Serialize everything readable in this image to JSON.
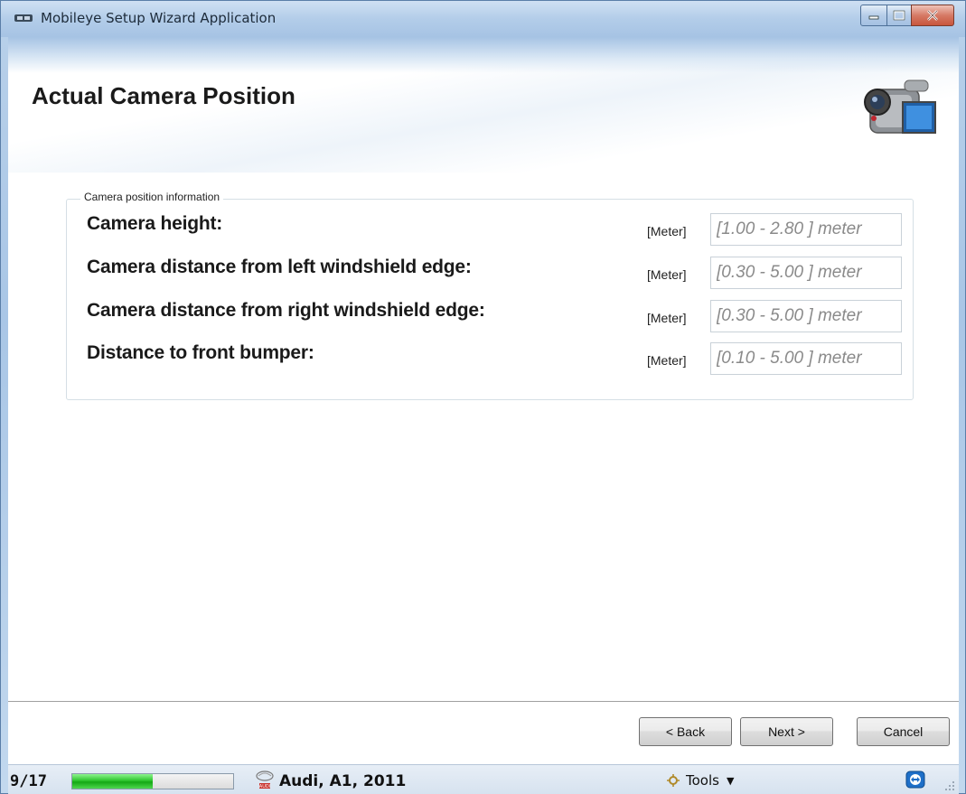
{
  "window": {
    "title": "Mobileye Setup Wizard Application",
    "controls": {
      "minimize": "minimize",
      "maximize": "maximize",
      "close": "close"
    }
  },
  "header": {
    "title": "Actual Camera Position",
    "icon": "camcorder-icon"
  },
  "group": {
    "legend": "Camera position information",
    "rows": [
      {
        "label": "Camera height:",
        "unit": "[Meter]",
        "placeholder": "[1.00 - 2.80 ] meter"
      },
      {
        "label": "Camera distance from left windshield edge:",
        "unit": "[Meter]",
        "placeholder": "[0.30 - 5.00 ] meter"
      },
      {
        "label": "Camera distance from right windshield edge:",
        "unit": "[Meter]",
        "placeholder": "[0.30 - 5.00 ] meter"
      },
      {
        "label": "Distance to front bumper:",
        "unit": "[Meter]",
        "placeholder": "[0.10 - 5.00 ] meter"
      }
    ]
  },
  "buttons": {
    "back": "< Back",
    "next": "Next >",
    "cancel": "Cancel"
  },
  "status": {
    "step": "9/17",
    "progress_fraction": 0.5,
    "vehicle": "Audi, A1, 2011",
    "tools": "Tools"
  },
  "colors": {
    "progress": "#2fc52f",
    "title_bar": "#b3cde9",
    "close_button": "#c8553c"
  }
}
